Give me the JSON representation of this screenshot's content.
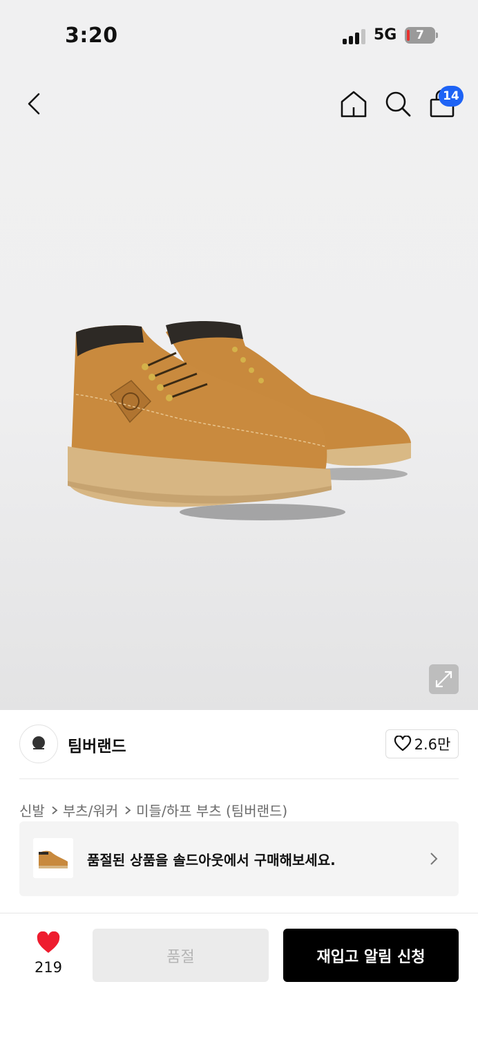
{
  "status_bar": {
    "time": "3:20",
    "network": "5G",
    "battery": "7"
  },
  "nav": {
    "cart_count": "14"
  },
  "brand": {
    "name": "팀버랜드",
    "likes": "2.6만"
  },
  "breadcrumb": [
    "신발",
    "부츠/워커",
    "미들/하프 부츠 (팀버랜드)"
  ],
  "soldout_banner": {
    "text": "품절된 상품을 솔드아웃에서 구매해보세요."
  },
  "bottom": {
    "wish_count": "219",
    "soldout_label": "품절",
    "restock_label": "재입고 알림 신청"
  },
  "colors": {
    "accent": "#1e63f5",
    "heart": "#ee1c2e",
    "boot": "#c8893d",
    "primary_button": "#000000"
  },
  "icons": [
    "back-icon",
    "home-icon",
    "search-icon",
    "shopping-bag-icon",
    "expand-icon",
    "heart-outline-icon",
    "chevron-right-icon",
    "heart-filled-icon"
  ]
}
